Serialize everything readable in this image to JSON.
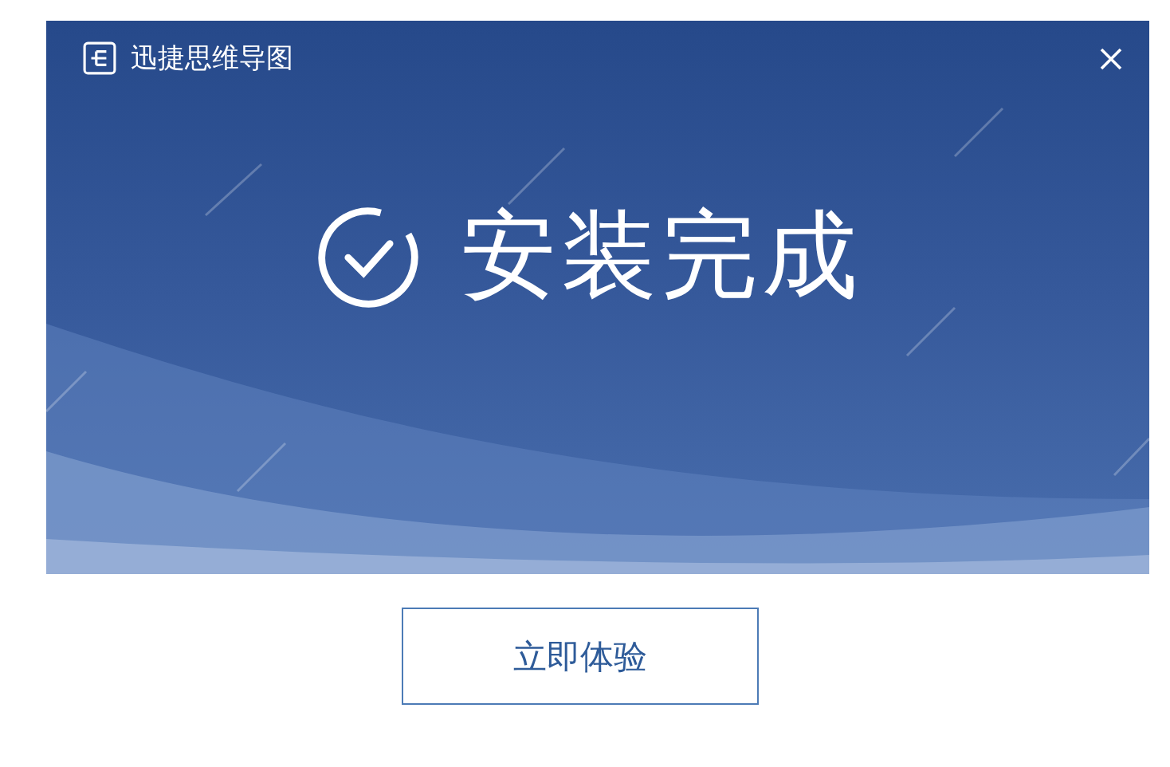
{
  "window": {
    "title": "迅捷思维导图"
  },
  "banner": {
    "message": "安装完成"
  },
  "buttons": [
    {
      "label": "立即体验"
    }
  ]
}
